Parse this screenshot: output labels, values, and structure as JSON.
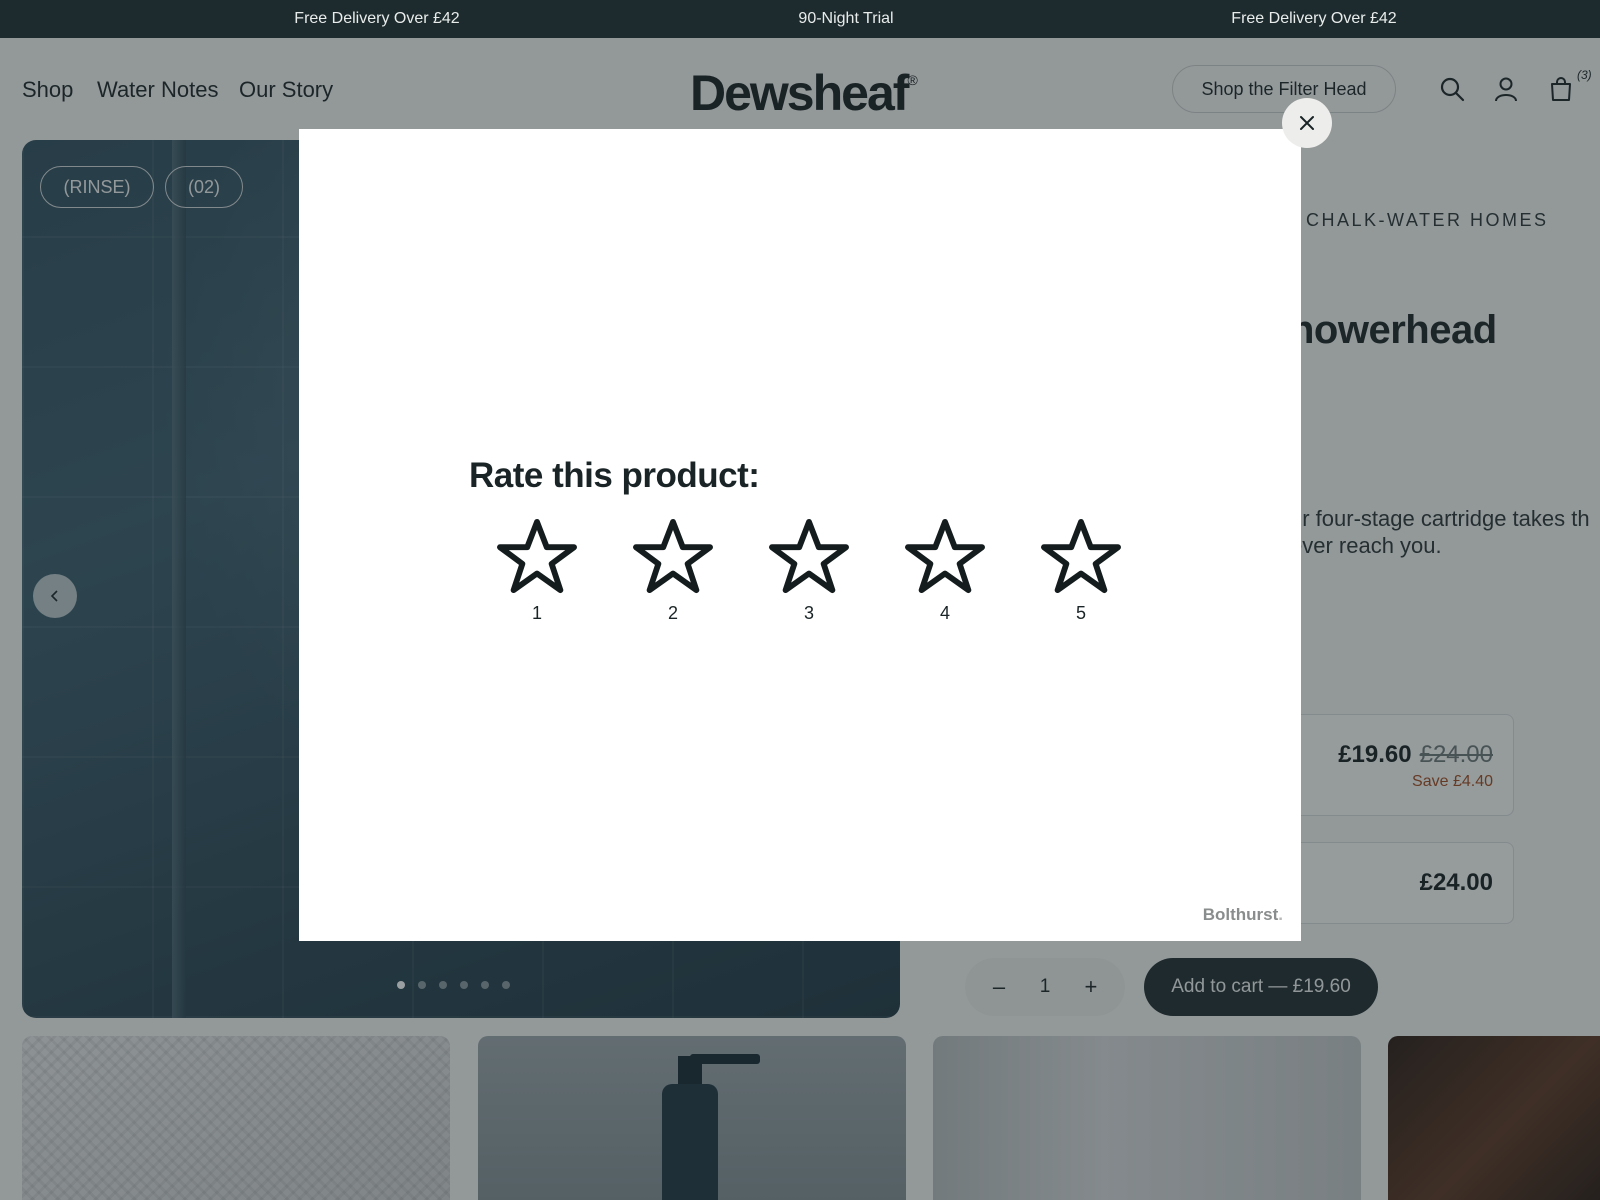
{
  "announcement": {
    "left": "Free Delivery Over £42",
    "center": "90-Night Trial",
    "right": "Free Delivery Over £42"
  },
  "header": {
    "nav": [
      "Shop",
      "Water Notes",
      "Our Story"
    ],
    "logo": "Dewsheaf",
    "logo_mark": "®",
    "cta": "Shop the Filter Head",
    "cart_count": "(3)",
    "icons": [
      "search-icon",
      "account-icon",
      "cart-icon"
    ]
  },
  "gallery": {
    "tags": [
      "(RINSE)",
      "(02)"
    ],
    "dots_total": 6,
    "active_dot": 1
  },
  "product": {
    "eyebrow": "CHALK-WATER HOMES",
    "title_fragment": "nowerhead",
    "description_lines": [
      "ur four-stage cartridge takes th",
      "ever reach you."
    ],
    "option1": {
      "price": "£19.60",
      "was": "£24.00",
      "save": "Save £4.40"
    },
    "option2": {
      "price": "£24.00"
    },
    "quantity": "1",
    "qty_minus": "–",
    "qty_plus": "+",
    "add_to_cart": "Add to cart — £19.60"
  },
  "modal": {
    "title": "Rate this product:",
    "stars": [
      "1",
      "2",
      "3",
      "4",
      "5"
    ],
    "powered_by": "Bolthurst",
    "powered_dot": "."
  },
  "colors": {
    "dark": "#1e2b2e",
    "save": "#a04a20",
    "overlay": "rgba(30,42,46,0.45)"
  }
}
